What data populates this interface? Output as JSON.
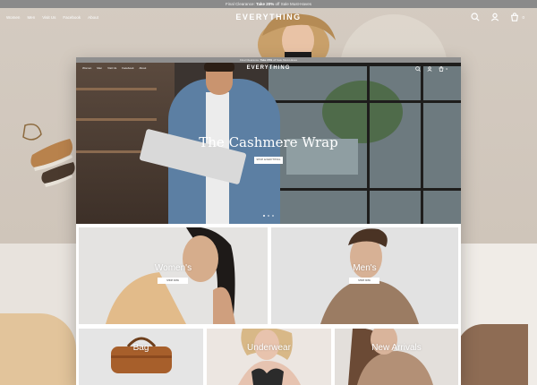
{
  "colors": {
    "background": "#d6ccc2",
    "topbar": "#8a8a8a",
    "accent_text": "#ffffff"
  },
  "background_site": {
    "announcement": {
      "prefix": "Final Clearance:",
      "highlight": "Take 20%",
      "suffix": "off Sale Must-Haves"
    },
    "menu": [
      "Women",
      "Men",
      "Visit Us",
      "Facebook",
      "About"
    ],
    "logo": "EVERYTHING",
    "cart_count": "0"
  },
  "mockup": {
    "announcement": {
      "prefix": "Final Clearance:",
      "highlight": "Take 20%",
      "suffix": "off Sale Must-Haves"
    },
    "menu": [
      "Women",
      "Men",
      "Visit Us",
      "Facebook",
      "About"
    ],
    "logo": "EVERYTHING",
    "cart_count": "0",
    "hero": {
      "headline": "The Cashmere Wrap",
      "cta": "SHOP EVERYTHING",
      "slides": 3,
      "active_slide": 1
    },
    "categories": [
      {
        "id": "women",
        "label": "Women's",
        "button": "SHOP NOW"
      },
      {
        "id": "men",
        "label": "Men's",
        "button": "SHOP NOW"
      },
      {
        "id": "bag",
        "label": "Bag"
      },
      {
        "id": "under",
        "label": "Underwear"
      },
      {
        "id": "newarr",
        "label": "New Arrivals"
      }
    ]
  },
  "icons": [
    "search-icon",
    "user-icon",
    "cart-icon"
  ]
}
